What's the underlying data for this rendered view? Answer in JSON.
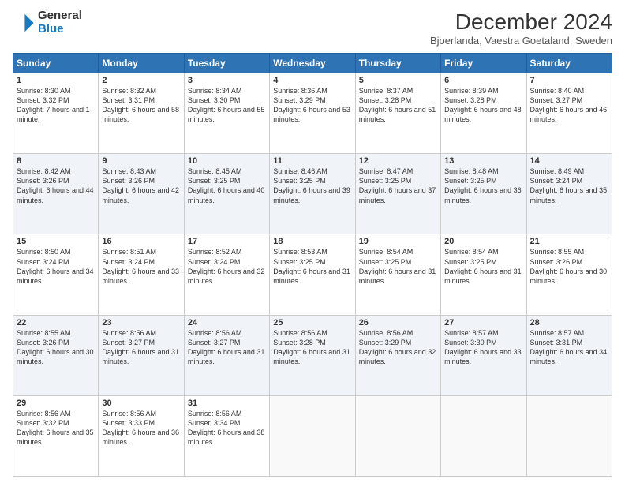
{
  "logo": {
    "general": "General",
    "blue": "Blue"
  },
  "header": {
    "title": "December 2024",
    "subtitle": "Bjoerlanda, Vaestra Goetaland, Sweden"
  },
  "days_of_week": [
    "Sunday",
    "Monday",
    "Tuesday",
    "Wednesday",
    "Thursday",
    "Friday",
    "Saturday"
  ],
  "weeks": [
    [
      {
        "day": "1",
        "sunrise": "8:30 AM",
        "sunset": "3:32 PM",
        "daylight": "7 hours and 1 minute."
      },
      {
        "day": "2",
        "sunrise": "8:32 AM",
        "sunset": "3:31 PM",
        "daylight": "6 hours and 58 minutes."
      },
      {
        "day": "3",
        "sunrise": "8:34 AM",
        "sunset": "3:30 PM",
        "daylight": "6 hours and 55 minutes."
      },
      {
        "day": "4",
        "sunrise": "8:36 AM",
        "sunset": "3:29 PM",
        "daylight": "6 hours and 53 minutes."
      },
      {
        "day": "5",
        "sunrise": "8:37 AM",
        "sunset": "3:28 PM",
        "daylight": "6 hours and 51 minutes."
      },
      {
        "day": "6",
        "sunrise": "8:39 AM",
        "sunset": "3:28 PM",
        "daylight": "6 hours and 48 minutes."
      },
      {
        "day": "7",
        "sunrise": "8:40 AM",
        "sunset": "3:27 PM",
        "daylight": "6 hours and 46 minutes."
      }
    ],
    [
      {
        "day": "8",
        "sunrise": "8:42 AM",
        "sunset": "3:26 PM",
        "daylight": "6 hours and 44 minutes."
      },
      {
        "day": "9",
        "sunrise": "8:43 AM",
        "sunset": "3:26 PM",
        "daylight": "6 hours and 42 minutes."
      },
      {
        "day": "10",
        "sunrise": "8:45 AM",
        "sunset": "3:25 PM",
        "daylight": "6 hours and 40 minutes."
      },
      {
        "day": "11",
        "sunrise": "8:46 AM",
        "sunset": "3:25 PM",
        "daylight": "6 hours and 39 minutes."
      },
      {
        "day": "12",
        "sunrise": "8:47 AM",
        "sunset": "3:25 PM",
        "daylight": "6 hours and 37 minutes."
      },
      {
        "day": "13",
        "sunrise": "8:48 AM",
        "sunset": "3:25 PM",
        "daylight": "6 hours and 36 minutes."
      },
      {
        "day": "14",
        "sunrise": "8:49 AM",
        "sunset": "3:24 PM",
        "daylight": "6 hours and 35 minutes."
      }
    ],
    [
      {
        "day": "15",
        "sunrise": "8:50 AM",
        "sunset": "3:24 PM",
        "daylight": "6 hours and 34 minutes."
      },
      {
        "day": "16",
        "sunrise": "8:51 AM",
        "sunset": "3:24 PM",
        "daylight": "6 hours and 33 minutes."
      },
      {
        "day": "17",
        "sunrise": "8:52 AM",
        "sunset": "3:24 PM",
        "daylight": "6 hours and 32 minutes."
      },
      {
        "day": "18",
        "sunrise": "8:53 AM",
        "sunset": "3:25 PM",
        "daylight": "6 hours and 31 minutes."
      },
      {
        "day": "19",
        "sunrise": "8:54 AM",
        "sunset": "3:25 PM",
        "daylight": "6 hours and 31 minutes."
      },
      {
        "day": "20",
        "sunrise": "8:54 AM",
        "sunset": "3:25 PM",
        "daylight": "6 hours and 31 minutes."
      },
      {
        "day": "21",
        "sunrise": "8:55 AM",
        "sunset": "3:26 PM",
        "daylight": "6 hours and 30 minutes."
      }
    ],
    [
      {
        "day": "22",
        "sunrise": "8:55 AM",
        "sunset": "3:26 PM",
        "daylight": "6 hours and 30 minutes."
      },
      {
        "day": "23",
        "sunrise": "8:56 AM",
        "sunset": "3:27 PM",
        "daylight": "6 hours and 31 minutes."
      },
      {
        "day": "24",
        "sunrise": "8:56 AM",
        "sunset": "3:27 PM",
        "daylight": "6 hours and 31 minutes."
      },
      {
        "day": "25",
        "sunrise": "8:56 AM",
        "sunset": "3:28 PM",
        "daylight": "6 hours and 31 minutes."
      },
      {
        "day": "26",
        "sunrise": "8:56 AM",
        "sunset": "3:29 PM",
        "daylight": "6 hours and 32 minutes."
      },
      {
        "day": "27",
        "sunrise": "8:57 AM",
        "sunset": "3:30 PM",
        "daylight": "6 hours and 33 minutes."
      },
      {
        "day": "28",
        "sunrise": "8:57 AM",
        "sunset": "3:31 PM",
        "daylight": "6 hours and 34 minutes."
      }
    ],
    [
      {
        "day": "29",
        "sunrise": "8:56 AM",
        "sunset": "3:32 PM",
        "daylight": "6 hours and 35 minutes."
      },
      {
        "day": "30",
        "sunrise": "8:56 AM",
        "sunset": "3:33 PM",
        "daylight": "6 hours and 36 minutes."
      },
      {
        "day": "31",
        "sunrise": "8:56 AM",
        "sunset": "3:34 PM",
        "daylight": "6 hours and 38 minutes."
      },
      null,
      null,
      null,
      null
    ]
  ]
}
